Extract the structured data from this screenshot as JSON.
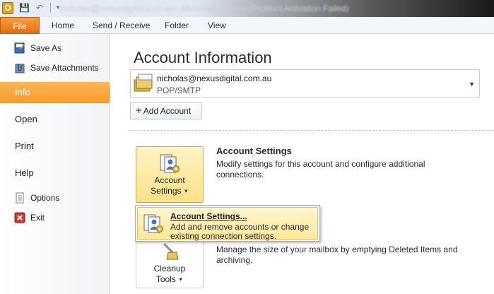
{
  "titlebar": {
    "app_icon_letter": "O",
    "title": "nicholas@nexusdigital.com.au - Microsoft Outlook (Product Activation Failed)"
  },
  "ribbon": {
    "file_label": "File",
    "tabs": [
      "Home",
      "Send / Receive",
      "Folder",
      "View"
    ]
  },
  "nav": {
    "save_as": "Save As",
    "save_attachments": "Save Attachments",
    "info": "Info",
    "open": "Open",
    "print": "Print",
    "help": "Help",
    "options": "Options",
    "exit": "Exit"
  },
  "main": {
    "title": "Account Information",
    "account": {
      "email": "nicholas@nexusdigital.com.au",
      "type": "POP/SMTP"
    },
    "add_account": "Add Account",
    "account_settings": {
      "button_line1": "Account",
      "button_line2": "Settings",
      "title": "Account Settings",
      "description": "Modify settings for this account and configure additional connections."
    },
    "cleanup": {
      "button_line1": "Cleanup",
      "button_line2": "Tools",
      "description": "Manage the size of your mailbox by emptying Deleted Items and archiving."
    },
    "popup": {
      "title": "Account Settings...",
      "description": "Add and remove accounts or change existing connection settings."
    }
  },
  "colors": {
    "file_tab": "#e76b12",
    "selected_nav": "#f79a29",
    "highlight": "#fde28a"
  }
}
